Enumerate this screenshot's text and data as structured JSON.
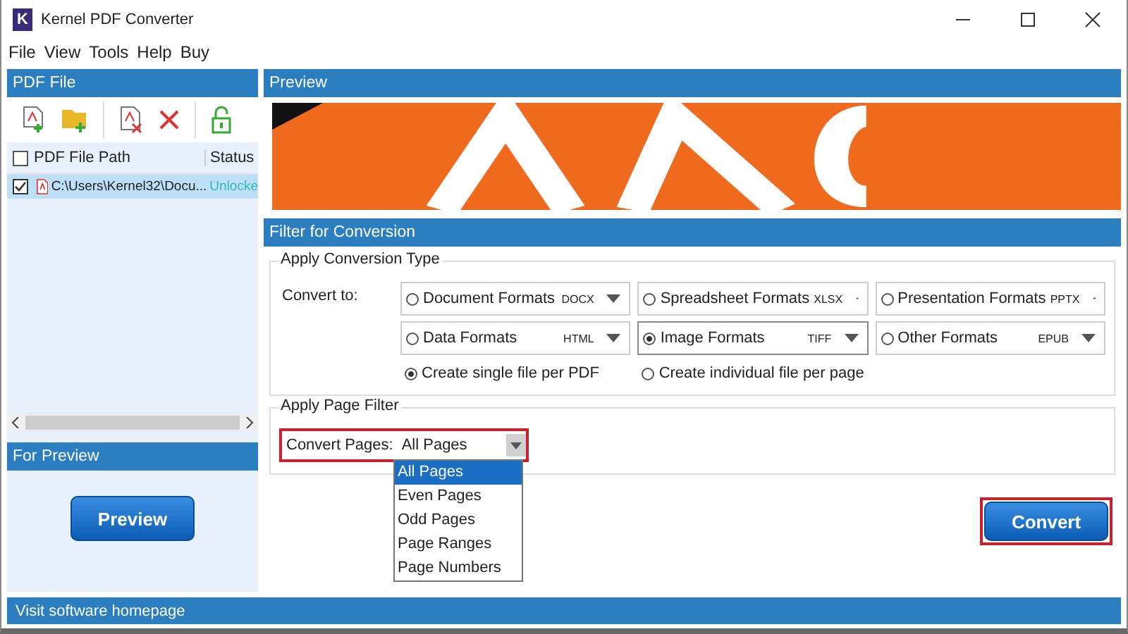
{
  "window": {
    "title": "Kernel PDF Converter",
    "logo": "K"
  },
  "menu": [
    "File",
    "View",
    "Tools",
    "Help",
    "Buy"
  ],
  "pdf_panel": {
    "header": "PDF File",
    "header_checked": false,
    "columns": [
      "PDF File Path",
      "Status"
    ],
    "rows": [
      {
        "path": "C:\\Users\\Kernel32\\Docu...",
        "status": "Unlocke",
        "checked": true,
        "selected": true
      }
    ]
  },
  "for_preview": {
    "header": "For Preview",
    "button": "Preview"
  },
  "preview": {
    "header": "Preview"
  },
  "filter": {
    "header": "Filter for Conversion",
    "conversion": {
      "legend": "Apply Conversion Type",
      "label": "Convert to:",
      "formats": [
        {
          "label": "Document Formats",
          "value": "DOCX",
          "selected": false
        },
        {
          "label": "Spreadsheet Formats",
          "value": "XLSX",
          "selected": false
        },
        {
          "label": "Presentation Formats",
          "value": "PPTX",
          "selected": false
        },
        {
          "label": "Data Formats",
          "value": "HTML",
          "selected": false
        },
        {
          "label": "Image Formats",
          "value": "TIFF",
          "selected": true
        },
        {
          "label": "Other Formats",
          "value": "EPUB",
          "selected": false
        }
      ],
      "output_options": [
        {
          "label": "Create single file per PDF",
          "selected": true
        },
        {
          "label": "Create individual file per page",
          "selected": false
        }
      ]
    },
    "page_filter": {
      "legend": "Apply Page Filter",
      "label": "Convert Pages:",
      "value": "All Pages",
      "expanded": true,
      "options": [
        {
          "label": "All Pages",
          "selected": true
        },
        {
          "label": "Even Pages",
          "selected": false
        },
        {
          "label": "Odd Pages",
          "selected": false
        },
        {
          "label": "Page Ranges",
          "selected": false
        },
        {
          "label": "Page Numbers",
          "selected": false
        }
      ]
    }
  },
  "convert_button": "Convert",
  "status_bar": {
    "link": "Visit software homepage"
  }
}
